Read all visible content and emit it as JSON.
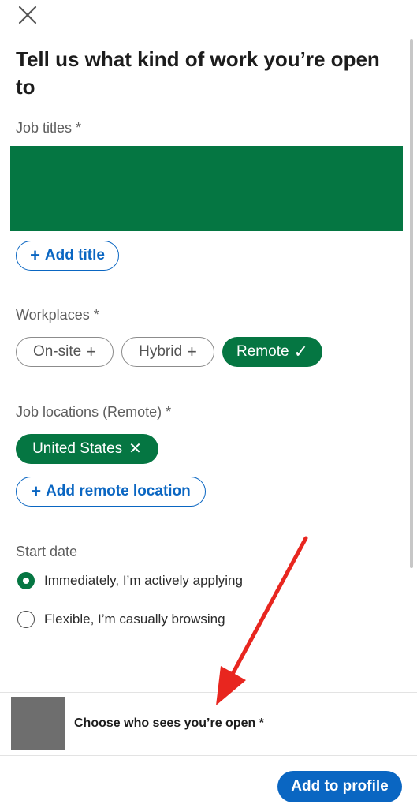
{
  "header": {
    "close_label": "Close",
    "title": "Tell us what kind of work you’re open to"
  },
  "job_titles": {
    "label": "Job titles *",
    "add_button": "Add title"
  },
  "workplaces": {
    "label": "Workplaces *",
    "options": [
      {
        "label": "On-site",
        "icon": "+",
        "selected": false
      },
      {
        "label": "Hybrid",
        "icon": "+",
        "selected": false
      },
      {
        "label": "Remote",
        "icon": "✓",
        "selected": true
      }
    ]
  },
  "job_locations": {
    "label": "Job locations (Remote) *",
    "selected_location": "United States",
    "remove_icon": "✕",
    "add_button": "Add remote location"
  },
  "start_date": {
    "label": "Start date",
    "options": [
      {
        "label": "Immediately, I’m actively applying",
        "checked": true
      },
      {
        "label": "Flexible, I’m casually browsing",
        "checked": false
      }
    ]
  },
  "visibility": {
    "label": "Choose who sees you’re open *"
  },
  "footer": {
    "primary_button": "Add to profile"
  },
  "colors": {
    "brand_green": "#057642",
    "brand_blue": "#0a66c2",
    "annotation_red": "#e8261f"
  }
}
